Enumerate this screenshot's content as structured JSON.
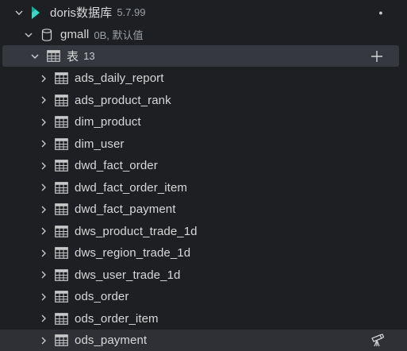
{
  "connection": {
    "name": "doris数据库",
    "version": "5.7.99",
    "status_dot": "●",
    "icon": "doris-logo-icon"
  },
  "database": {
    "name": "gmall",
    "meta": "0B, 默认值",
    "icon": "database-icon"
  },
  "tables_group": {
    "label": "表",
    "count": "13",
    "add_icon": "plus-icon"
  },
  "tables": [
    {
      "name": "ads_daily_report"
    },
    {
      "name": "ads_product_rank"
    },
    {
      "name": "dim_product"
    },
    {
      "name": "dim_user"
    },
    {
      "name": "dwd_fact_order"
    },
    {
      "name": "dwd_fact_order_item"
    },
    {
      "name": "dwd_fact_payment"
    },
    {
      "name": "dws_product_trade_1d"
    },
    {
      "name": "dws_region_trade_1d"
    },
    {
      "name": "dws_user_trade_1d"
    },
    {
      "name": "ods_order"
    },
    {
      "name": "ods_order_item"
    },
    {
      "name": "ods_payment"
    }
  ],
  "hovered_row_action": "telescope-icon",
  "colors": {
    "background": "#1e1f23",
    "selected_row": "#35383f",
    "hover_row": "#2e3036",
    "doris_logo": "#3dd6c6",
    "table_icon": "#c9c9c9"
  }
}
